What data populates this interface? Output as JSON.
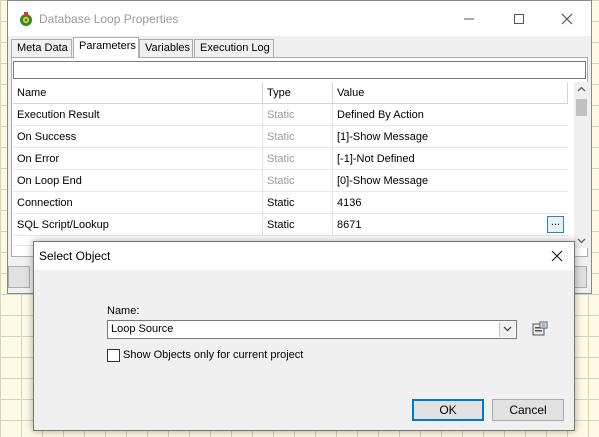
{
  "window": {
    "title": "Database Loop Properties"
  },
  "tabs": [
    {
      "label": "Meta Data"
    },
    {
      "label": "Parameters"
    },
    {
      "label": "Variables"
    },
    {
      "label": "Execution Log"
    }
  ],
  "grid": {
    "columns": [
      "Name",
      "Type",
      "Value"
    ],
    "rows": [
      {
        "name": "Execution Result",
        "type": "Static",
        "value": "Defined By Action"
      },
      {
        "name": "On Success",
        "type": "Static",
        "value": "[1]-Show Message"
      },
      {
        "name": "On Error",
        "type": "Static",
        "value": "[-1]-Not Defined"
      },
      {
        "name": "On Loop End",
        "type": "Static",
        "value": "[0]-Show Message"
      },
      {
        "name": "Connection",
        "type": "Static",
        "value": "4136"
      },
      {
        "name": "SQL Script/Lookup",
        "type": "Static",
        "value": "8671",
        "button": "..."
      }
    ]
  },
  "dialog": {
    "title": "Select Object",
    "name_label": "Name:",
    "name_value": "Loop Source",
    "checkbox_label": "Show Objects only for current project",
    "ok_label": "OK",
    "cancel_label": "Cancel"
  },
  "colors": {
    "accent": "#0078d7",
    "canvas": "#fdfbe6",
    "muted_text": "#9a9a9a"
  },
  "icons": [
    "app-gear-icon",
    "minimize-icon",
    "maximize-icon",
    "close-icon",
    "chevron-down-icon",
    "browse-icon",
    "scroll-up-icon",
    "scroll-down-icon"
  ]
}
